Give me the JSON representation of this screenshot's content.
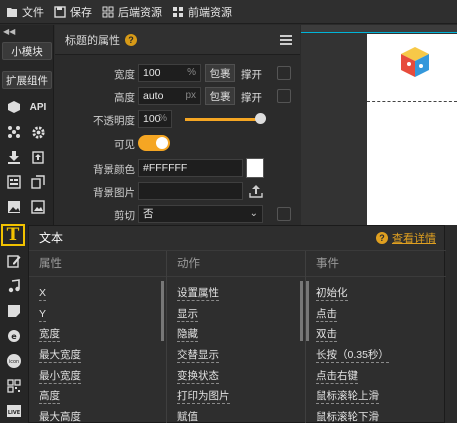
{
  "toolbar": {
    "file": "文件",
    "save": "保存",
    "backend": "后端资源",
    "frontend": "前端资源"
  },
  "left": {
    "small_module": "小模块",
    "ext_components": "扩展组件",
    "api_label": "API"
  },
  "panel": {
    "title": "标题的属性",
    "help": "?",
    "width_label": "宽度",
    "width_value": "100",
    "width_unit": "%",
    "height_label": "高度",
    "height_value": "auto",
    "height_unit": "px",
    "wrap_label": "包裹",
    "stretch_label": "撑开",
    "opacity_label": "不透明度",
    "opacity_value": "100",
    "opacity_unit": "%",
    "visible_label": "可见",
    "bgcolor_label": "背景颜色",
    "bgcolor_value": "#FFFFFF",
    "bgimage_label": "背景图片",
    "clip_label": "剪切",
    "clip_value": "否"
  },
  "popup": {
    "title": "文本",
    "docs_link": "查看详情",
    "columns": [
      {
        "header": "属性",
        "items": [
          "X",
          "Y",
          "宽度",
          "最大宽度",
          "最小宽度",
          "高度",
          "最大高度"
        ]
      },
      {
        "header": "动作",
        "items": [
          "设置属性",
          "显示",
          "隐藏",
          "交替显示",
          "变换状态",
          "打印为图片",
          "赋值"
        ]
      },
      {
        "header": "事件",
        "items": [
          "初始化",
          "点击",
          "双击",
          "长按（0.35秒）",
          "点击右键",
          "鼠标滚轮上滑",
          "鼠标滚轮下滑"
        ]
      }
    ]
  },
  "colors": {
    "accent": "#E0A020",
    "toggle": "#F5A623",
    "selection": "#F2C200"
  }
}
